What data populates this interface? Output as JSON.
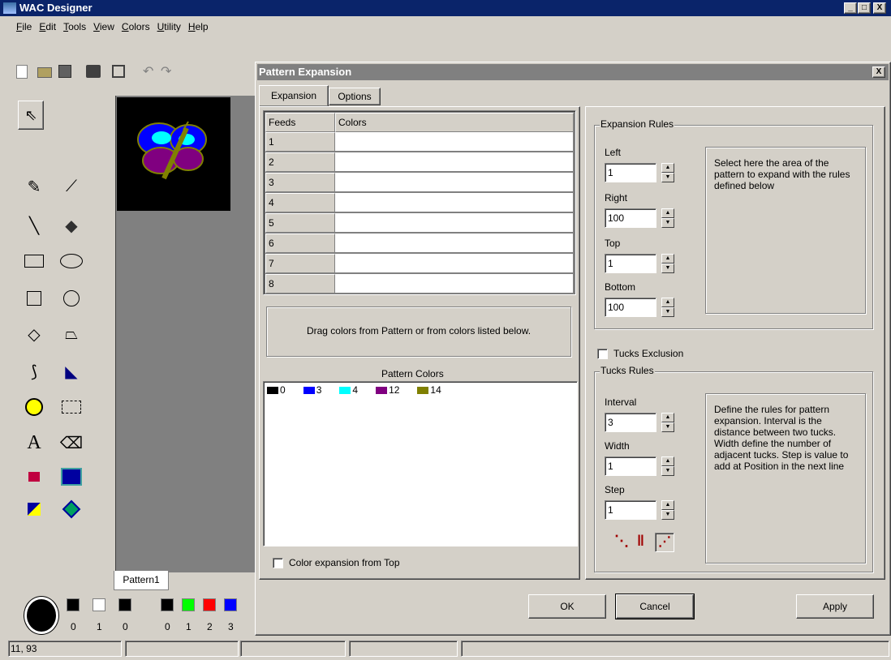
{
  "app": {
    "title": "WAC Designer",
    "minimize": "_",
    "maximize": "□",
    "close": "X"
  },
  "menu": [
    {
      "u": "F",
      "rest": "ile"
    },
    {
      "u": "E",
      "rest": "dit"
    },
    {
      "u": "T",
      "rest": "ools"
    },
    {
      "u": "V",
      "rest": "iew"
    },
    {
      "u": "C",
      "rest": "olors"
    },
    {
      "u": "U",
      "rest": "tility"
    },
    {
      "u": "H",
      "rest": "elp"
    }
  ],
  "canvas_tab": "Pattern1",
  "palette": {
    "mouse_labels": [
      "0",
      "1",
      "0"
    ],
    "color_labels": [
      "0",
      "1",
      "2",
      "3"
    ],
    "colors": [
      "#000000",
      "#00ff00",
      "#ff0000",
      "#0000ff"
    ],
    "mouse_colors": [
      "#000000",
      "#ffffff",
      "#000000"
    ]
  },
  "status": {
    "coords": "11, 93"
  },
  "dialog": {
    "title": "Pattern Expansion",
    "close": "X",
    "tabs": [
      "Expansion",
      "Options"
    ],
    "grid": {
      "headers": [
        "Feeds",
        "Colors"
      ],
      "rows": [
        "1",
        "2",
        "3",
        "4",
        "5",
        "6",
        "7",
        "8"
      ]
    },
    "drag_hint": "Drag colors from Pattern or from colors listed below.",
    "pattern_colors_label": "Pattern Colors",
    "pattern_colors": [
      {
        "label": "0",
        "color": "#000000"
      },
      {
        "label": "3",
        "color": "#0000ff"
      },
      {
        "label": "4",
        "color": "#00ffff"
      },
      {
        "label": "12",
        "color": "#800080"
      },
      {
        "label": "14",
        "color": "#808000"
      }
    ],
    "color_expansion_label": "Color expansion from Top",
    "expansion_rules": {
      "legend": "Expansion Rules",
      "left_label": "Left",
      "left": "1",
      "right_label": "Right",
      "right": "100",
      "top_label": "Top",
      "top": "1",
      "bottom_label": "Bottom",
      "bottom": "100",
      "help": "Select here the area of the pattern to expand with the rules defined below"
    },
    "tucks_exclusion_label": "Tucks Exclusion",
    "tucks_rules": {
      "legend": "Tucks Rules",
      "interval_label": "Interval",
      "interval": "3",
      "width_label": "Width",
      "width": "1",
      "step_label": "Step",
      "step": "1",
      "help": "Define the rules for pattern expansion. Interval is the distance between two tucks. Width define the number of adjacent tucks. Step is value to add at Position in the next line"
    },
    "buttons": {
      "ok": "OK",
      "cancel": "Cancel",
      "apply": "Apply"
    }
  }
}
